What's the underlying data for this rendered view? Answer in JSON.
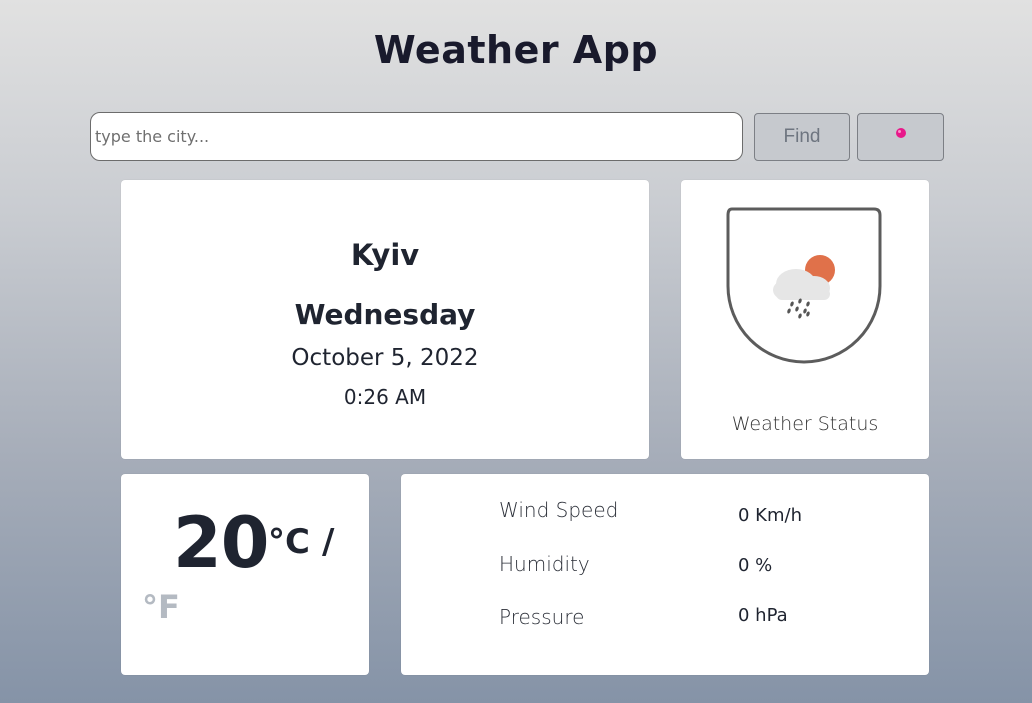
{
  "app": {
    "title": "Weather App"
  },
  "search": {
    "placeholder": "type the city...",
    "find_label": "Find",
    "location_icon": "location-dot-icon"
  },
  "location": {
    "city": "Kyiv",
    "weekday": "Wednesday",
    "date": "October 5, 2022",
    "time": "0:26 AM"
  },
  "status": {
    "icon": "cloud-sun-rain-icon",
    "label": "Weather Status"
  },
  "temperature": {
    "value": "20",
    "unit_celsius": "°C",
    "separator": "/",
    "unit_fahrenheit": "°F"
  },
  "details": [
    {
      "label": "Wind Speed",
      "value": "0 Km/h"
    },
    {
      "label": "Humidity",
      "value": "0 %"
    },
    {
      "label": "Pressure",
      "value": "0 hPa"
    }
  ],
  "colors": {
    "accent_location": "#e8188a",
    "sun": "#e0714a",
    "unit_inactive": "#b4bac2"
  }
}
